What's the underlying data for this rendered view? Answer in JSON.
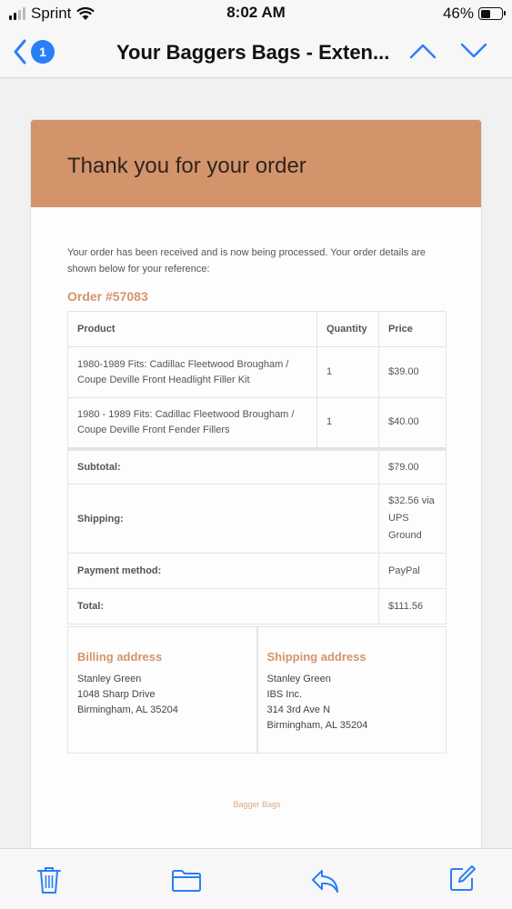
{
  "status": {
    "carrier": "Sprint",
    "time": "8:02 AM",
    "battery": "46%"
  },
  "nav": {
    "back_count": "1",
    "title": "Your Baggers Bags - Exten..."
  },
  "email": {
    "heading": "Thank you for your order",
    "intro": "Your order has been received and is now being processed. Your order details are shown below for your reference:",
    "order_number": "Order #57083",
    "columns": [
      "Product",
      "Quantity",
      "Price"
    ],
    "items": [
      {
        "product": "1980-1989 Fits: Cadillac Fleetwood Brougham / Coupe Deville Front Headlight Filler Kit",
        "quantity": "1",
        "price": "$39.00"
      },
      {
        "product": "1980 - 1989 Fits: Cadillac Fleetwood Brougham / Coupe Deville Front Fender Fillers",
        "quantity": "1",
        "price": "$40.00"
      }
    ],
    "totals": {
      "subtotal_label": "Subtotal:",
      "subtotal": "$79.00",
      "shipping_label": "Shipping:",
      "shipping_lines": [
        "$32.56 via",
        "UPS",
        "Ground"
      ],
      "payment_label": "Payment method:",
      "payment": "PayPal",
      "total_label": "Total:",
      "total": "$111.56"
    },
    "billing": {
      "title": "Billing address",
      "lines": [
        "Stanley Green",
        "1048 Sharp Drive",
        "Birmingham, AL 35204"
      ]
    },
    "shipping": {
      "title": "Shipping address",
      "lines": [
        "Stanley Green",
        "IBS Inc.",
        "314 3rd Ave N",
        "Birmingham, AL 35204"
      ]
    },
    "footer": "Bagger Bags"
  },
  "colors": {
    "accent": "#d4946b",
    "ios_blue": "#2a7ff6"
  },
  "icons": {
    "back": "chevron-left-icon",
    "prev": "chevron-up-icon",
    "next": "chevron-down-icon",
    "trash": "trash-icon",
    "folder": "folder-icon",
    "reply": "reply-icon",
    "compose": "compose-icon"
  }
}
